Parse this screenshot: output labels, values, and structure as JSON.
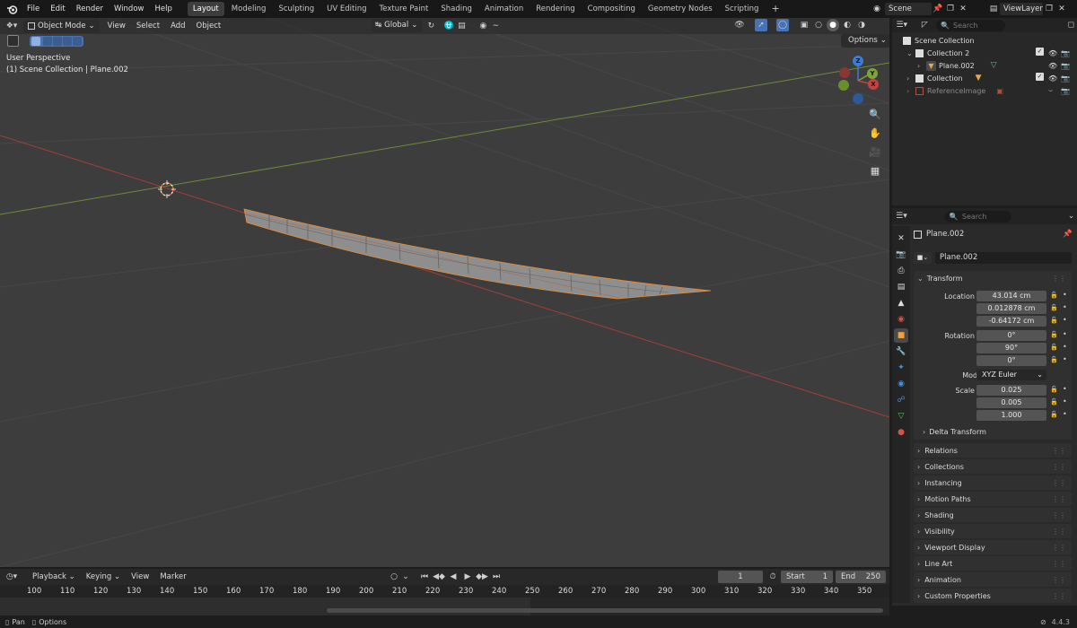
{
  "topbar": {
    "menus": [
      "File",
      "Edit",
      "Render",
      "Window",
      "Help"
    ],
    "workspaces": [
      "Layout",
      "Modeling",
      "Sculpting",
      "UV Editing",
      "Texture Paint",
      "Shading",
      "Animation",
      "Rendering",
      "Compositing",
      "Geometry Nodes",
      "Scripting"
    ],
    "active_workspace": "Layout",
    "add_tab": "+",
    "scene": "Scene",
    "view_layer": "ViewLayer"
  },
  "viewport": {
    "mode": "Object Mode",
    "menus": [
      "View",
      "Select",
      "Add",
      "Object"
    ],
    "orientation": "Global",
    "options_label": "Options",
    "perspective": "User Perspective",
    "context": "(1) Scene Collection | Plane.002",
    "gizmo": {
      "z": "Z",
      "y": "Y",
      "x": "X"
    }
  },
  "outliner": {
    "search_placeholder": "Search",
    "root": "Scene Collection",
    "items": [
      {
        "label": "Collection 2",
        "indent": 1,
        "expanded": true
      },
      {
        "label": "Plane.002",
        "indent": 2
      },
      {
        "label": "Collection",
        "indent": 1,
        "expanded": false
      },
      {
        "label": "ReferenceImage",
        "indent": 1,
        "dimmed": true
      }
    ]
  },
  "properties": {
    "search_placeholder": "Search",
    "object_name": "Plane.002",
    "datablock_name": "Plane.002",
    "transform_label": "Transform",
    "location": {
      "label_x": "Location X",
      "label_y": "Y",
      "label_z": "Z",
      "x": "43.014 cm",
      "y": "0.012878 cm",
      "z": "-0.64172 cm"
    },
    "rotation": {
      "label_x": "Rotation X",
      "label_y": "Y",
      "label_z": "Z",
      "x": "0°",
      "y": "90°",
      "z": "0°"
    },
    "mode": {
      "label": "Mode",
      "value": "XYZ Euler"
    },
    "scale": {
      "label_x": "Scale X",
      "label_y": "Y",
      "label_z": "Z",
      "x": "0.025",
      "y": "0.005",
      "z": "1.000"
    },
    "delta_transform": "Delta Transform",
    "panels": [
      "Relations",
      "Collections",
      "Instancing",
      "Motion Paths",
      "Shading",
      "Visibility",
      "Viewport Display",
      "Line Art",
      "Animation",
      "Custom Properties"
    ]
  },
  "timeline": {
    "menus": [
      "Playback",
      "Keying",
      "View",
      "Marker"
    ],
    "current_frame": "1",
    "start_label": "Start",
    "start": "1",
    "end_label": "End",
    "end": "250",
    "ruler": [
      "100",
      "110",
      "120",
      "130",
      "140",
      "150",
      "160",
      "170",
      "180",
      "190",
      "200",
      "210",
      "220",
      "230",
      "240",
      "250",
      "260",
      "270",
      "280",
      "290",
      "300",
      "310",
      "320",
      "330",
      "340",
      "350"
    ]
  },
  "statusbar": {
    "pan": "Pan",
    "options": "Options",
    "version": "4.4.3"
  },
  "colors": {
    "x_axis": "#c4423f",
    "y_axis": "#7ea33b",
    "z_axis": "#3e7bd1",
    "origin": "#e8a74a",
    "highlight": "#4772b3"
  }
}
